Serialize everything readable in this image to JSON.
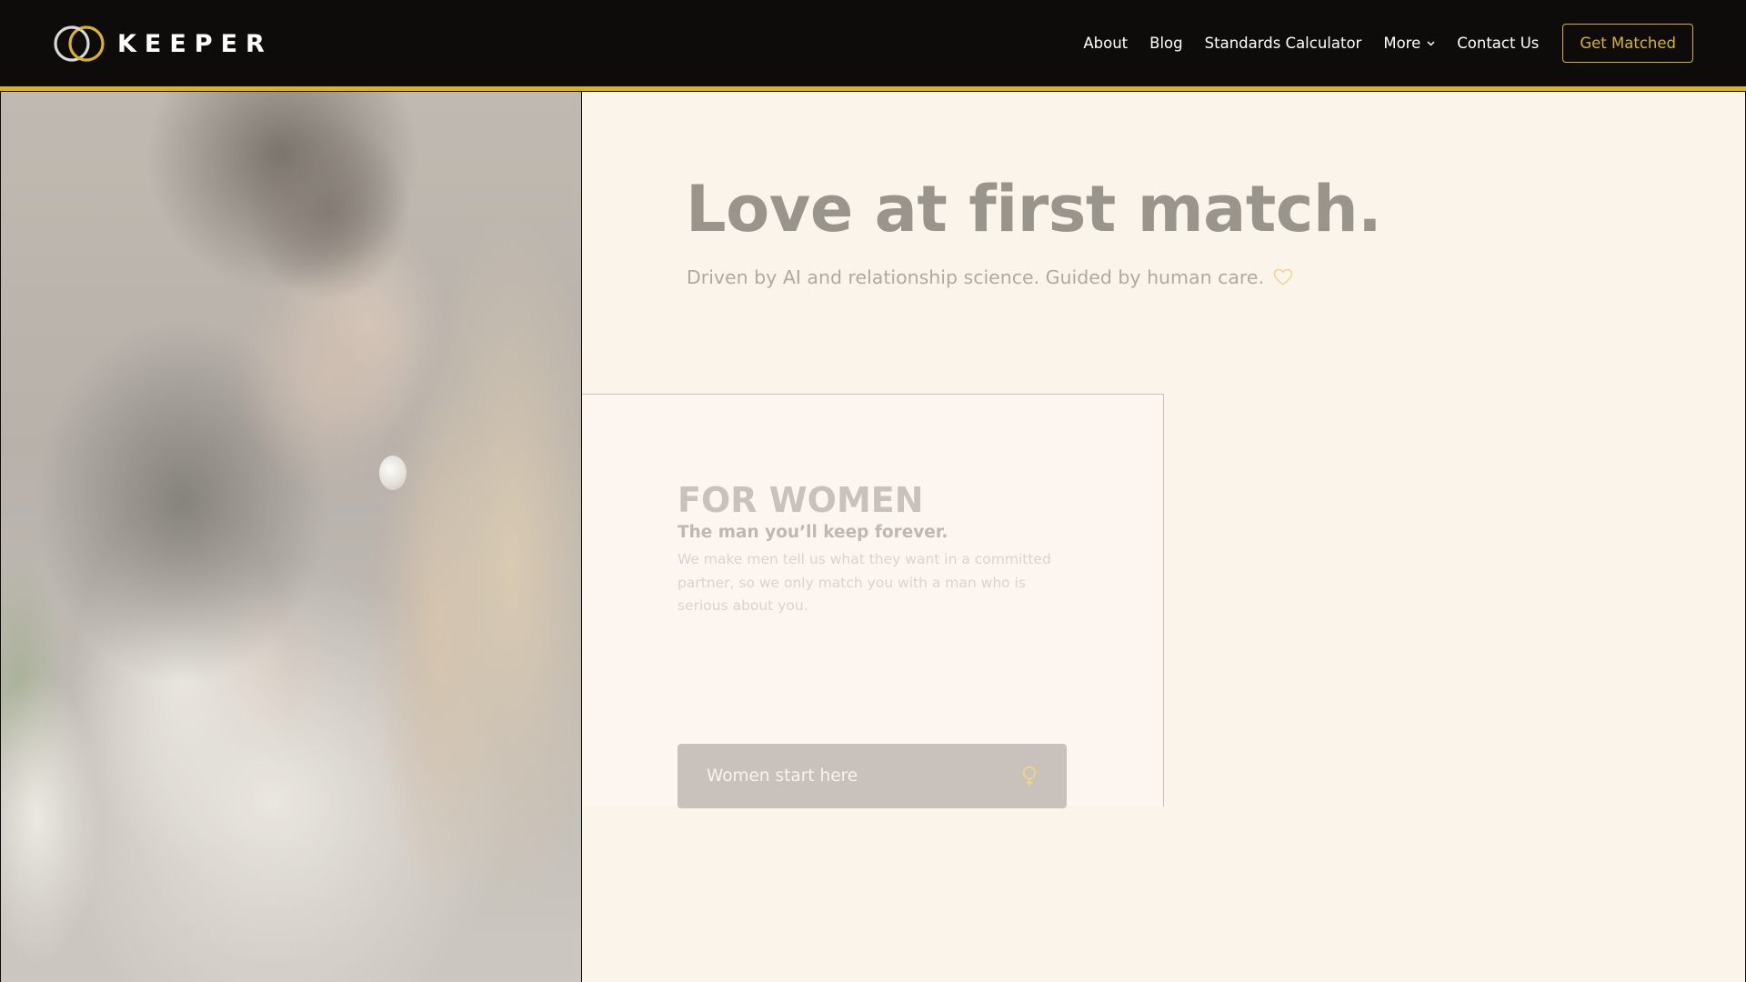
{
  "nav": {
    "brand": "KEEPER",
    "links": [
      {
        "label": "About"
      },
      {
        "label": "Blog"
      },
      {
        "label": "Standards Calculator"
      },
      {
        "label": "More",
        "has_dropdown": true
      },
      {
        "label": "Contact Us"
      }
    ],
    "cta_label": "Get Matched"
  },
  "hero": {
    "title": "Love at first match.",
    "subtitle": "Driven by AI and relationship science. Guided by human care.",
    "subtitle_icon": "heart-outline-icon"
  },
  "card": {
    "title": "FOR WOMEN",
    "subtitle": "The man you’ll keep forever.",
    "body": "We make men tell us what they want in a committed partner, so we only match you with a man who is serious about you.",
    "button_label": "Women start here",
    "button_icon": "female-symbol-icon"
  },
  "image": {
    "description": "Couple embracing; man kissing smiling bride in white dress holding white flowers"
  },
  "colors": {
    "brand_gold": "#d9b325",
    "nav_bg": "#0d0c0b",
    "page_bg": "#fbf4ea",
    "card_bg": "#fdf6f0",
    "button_bg": "#c9c1bb"
  }
}
